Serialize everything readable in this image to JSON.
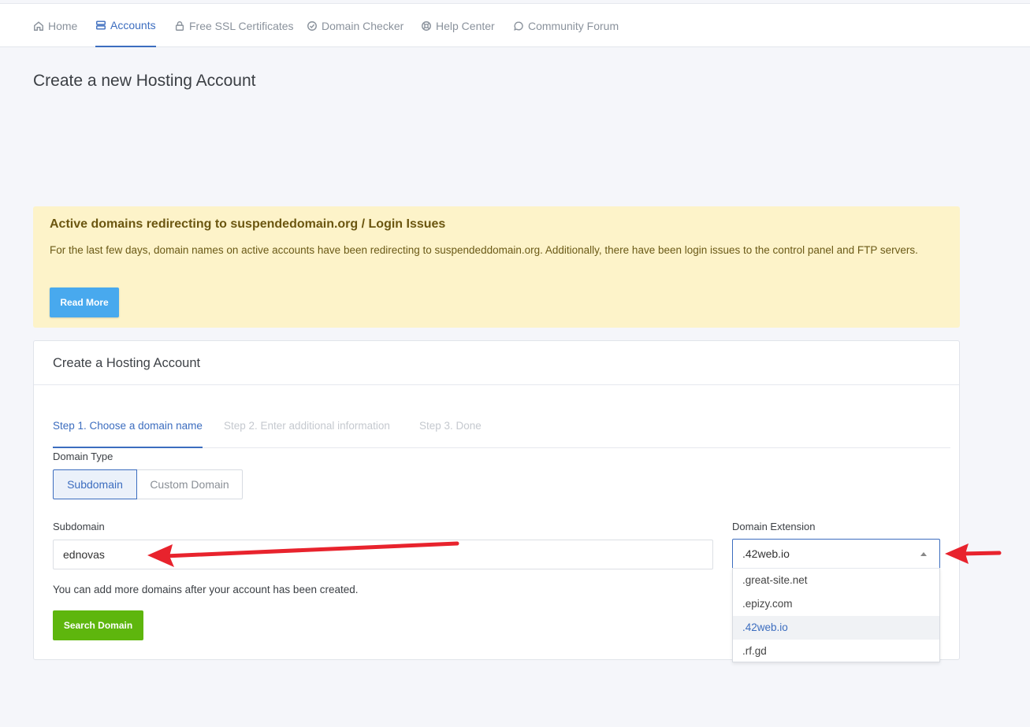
{
  "nav": {
    "items": [
      {
        "label": "Home",
        "icon": "home-icon"
      },
      {
        "label": "Accounts",
        "icon": "server-icon",
        "active": true
      },
      {
        "label": "Free SSL Certificates",
        "icon": "lock-icon"
      },
      {
        "label": "Domain Checker",
        "icon": "check-circle-icon"
      },
      {
        "label": "Help Center",
        "icon": "lifebuoy-icon"
      },
      {
        "label": "Community Forum",
        "icon": "chat-bubble-icon"
      }
    ]
  },
  "page": {
    "title": "Create a new Hosting Account"
  },
  "alert": {
    "title": "Active domains redirecting to suspendedomain.org / Login Issues",
    "text": "For the last few days, domain names on active accounts have been redirecting to suspendeddomain.org. Additionally, there have been login issues to the control panel and FTP servers.",
    "button": "Read More"
  },
  "card": {
    "title": "Create a Hosting Account",
    "steps": [
      "Step 1. Choose a domain name",
      "Step 2. Enter additional information",
      "Step 3. Done"
    ],
    "domain_type": {
      "label": "Domain Type",
      "options": [
        "Subdomain",
        "Custom Domain"
      ],
      "selected": "Subdomain"
    },
    "subdomain": {
      "label": "Subdomain",
      "value": "ednovas"
    },
    "extension": {
      "label": "Domain Extension",
      "selected": ".42web.io",
      "options": [
        ".great-site.net",
        ".epizy.com",
        ".42web.io",
        ".rf.gd"
      ]
    },
    "help": "You can add more domains after your account has been created.",
    "search_button": "Search Domain"
  },
  "colors": {
    "accent": "#3c6dbf",
    "alert_bg": "#fdf3c9",
    "read_more": "#48a9ee",
    "search": "#5eb60d",
    "annotation_arrow": "#e8232d"
  }
}
